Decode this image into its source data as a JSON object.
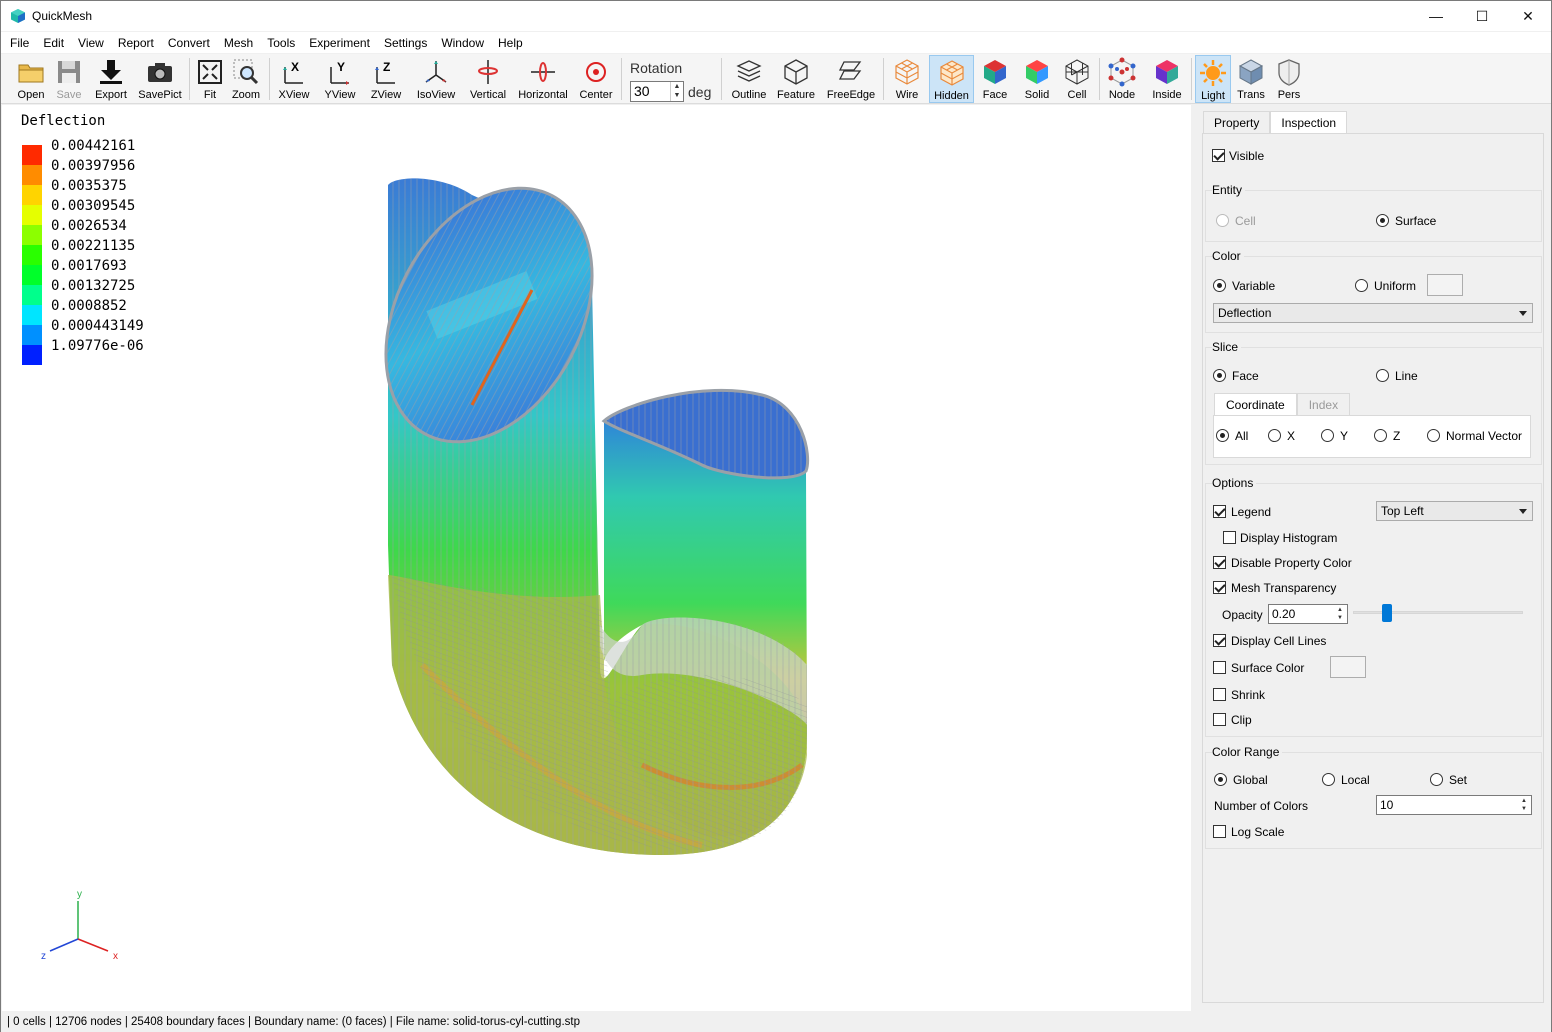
{
  "window": {
    "title": "QuickMesh"
  },
  "menu": [
    "File",
    "Edit",
    "View",
    "Report",
    "Convert",
    "Mesh",
    "Tools",
    "Experiment",
    "Settings",
    "Window",
    "Help"
  ],
  "toolbar": {
    "open": "Open",
    "save": "Save",
    "export": "Export",
    "savepict": "SavePict",
    "fit": "Fit",
    "zoom": "Zoom",
    "xview": "XView",
    "yview": "YView",
    "zview": "ZView",
    "isoview": "IsoView",
    "vertical": "Vertical",
    "horizontal": "Horizontal",
    "center": "Center",
    "rotation_label": "Rotation",
    "rotation_value": "30",
    "rotation_unit": "deg",
    "outline": "Outline",
    "feature": "Feature",
    "freeedge": "FreeEdge",
    "wire": "Wire",
    "hidden": "Hidden",
    "face": "Face",
    "solid": "Solid",
    "cell": "Cell",
    "node": "Node",
    "inside": "Inside",
    "light": "Light",
    "trans": "Trans",
    "pers": "Pers"
  },
  "legend": {
    "title": "Deflection",
    "values": [
      "0.00442161",
      "0.00397956",
      "0.0035375",
      "0.00309545",
      "0.0026534",
      "0.00221135",
      "0.0017693",
      "0.00132725",
      "0.0008852",
      "0.000443149",
      "1.09776e-06"
    ],
    "colors": [
      "#ff2a00",
      "#ff8c00",
      "#ffd400",
      "#e5ff00",
      "#8cff00",
      "#2aff00",
      "#00ff2a",
      "#00ff8c",
      "#00e5ff",
      "#0090ff",
      "#0020ff"
    ]
  },
  "axes": {
    "x": "x",
    "y": "y",
    "z": "z"
  },
  "panel": {
    "tabs": [
      "Property",
      "Inspection"
    ],
    "visible": "Visible",
    "entity": {
      "title": "Entity",
      "cell": "Cell",
      "surface": "Surface"
    },
    "color": {
      "title": "Color",
      "variable": "Variable",
      "uniform": "Uniform",
      "selected": "Deflection"
    },
    "slice": {
      "title": "Slice",
      "face": "Face",
      "line": "Line",
      "tab_coordinate": "Coordinate",
      "tab_index": "Index",
      "all": "All",
      "x": "X",
      "y": "Y",
      "z": "Z",
      "normal": "Normal Vector"
    },
    "options": {
      "title": "Options",
      "legend": "Legend",
      "legend_pos": "Top Left",
      "histogram": "Display Histogram",
      "disable_prop_color": "Disable Property Color",
      "mesh_transparency": "Mesh Transparency",
      "opacity_label": "Opacity",
      "opacity_value": "0.20",
      "opacity_level": 0.2,
      "cell_lines": "Display Cell Lines",
      "surface_color": "Surface Color",
      "shrink": "Shrink",
      "clip": "Clip"
    },
    "color_range": {
      "title": "Color Range",
      "global": "Global",
      "local": "Local",
      "set": "Set",
      "num_colors_label": "Number of Colors",
      "num_colors": "10",
      "log_scale": "Log Scale"
    }
  },
  "status": "| 0 cells | 12706 nodes | 25408 boundary faces |  Boundary name:  (0 faces) | File name: solid-torus-cyl-cutting.stp"
}
